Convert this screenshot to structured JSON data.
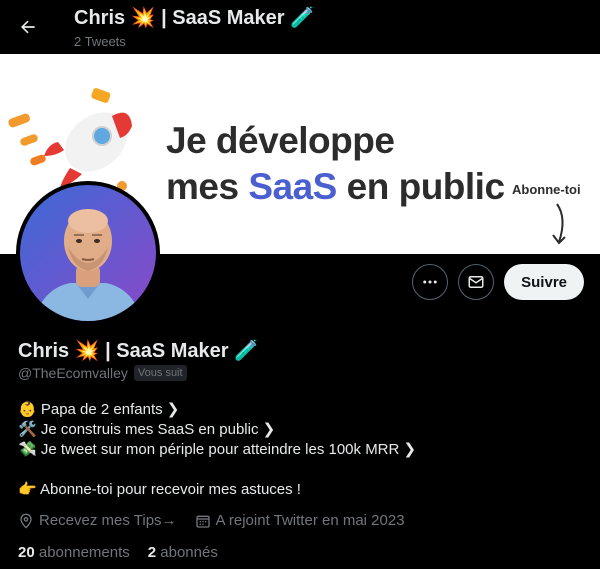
{
  "header": {
    "title": "Chris 💥 | SaaS Maker 🧪",
    "tweet_count": "2 Tweets"
  },
  "banner": {
    "line1": "Je développe",
    "line2_pre": "mes ",
    "line2_accent": "SaaS",
    "line2_post": " en public",
    "subscribe_label": "Abonne-toi"
  },
  "profile": {
    "name": "Chris 💥 | SaaS Maker 🧪",
    "handle": "@TheEcomvalley",
    "follows_you_badge": "Vous suit"
  },
  "actions": {
    "more_icon": "more-icon",
    "message_icon": "message-icon",
    "follow_label": "Suivre"
  },
  "bio": {
    "lines": [
      "👶 Papa de 2 enfants ❯",
      "🛠️ Je construis mes SaaS en public ❯",
      "💸 Je tweet sur mon périple pour atteindre les 100k MRR ❯",
      "👉 Abonne-toi pour recevoir mes astuces !"
    ]
  },
  "meta": {
    "location": "Recevez mes Tips→",
    "joined": "A rejoint Twitter en mai 2023"
  },
  "stats": {
    "following_count": "20",
    "following_label": "abonnements",
    "followers_count": "2",
    "followers_label": "abonnés"
  },
  "colors": {
    "background": "#000000",
    "text": "#e7e9ea",
    "muted": "#71767b",
    "banner_accent": "#4a5fd0",
    "avatar_bg": "#6a4fc8"
  }
}
